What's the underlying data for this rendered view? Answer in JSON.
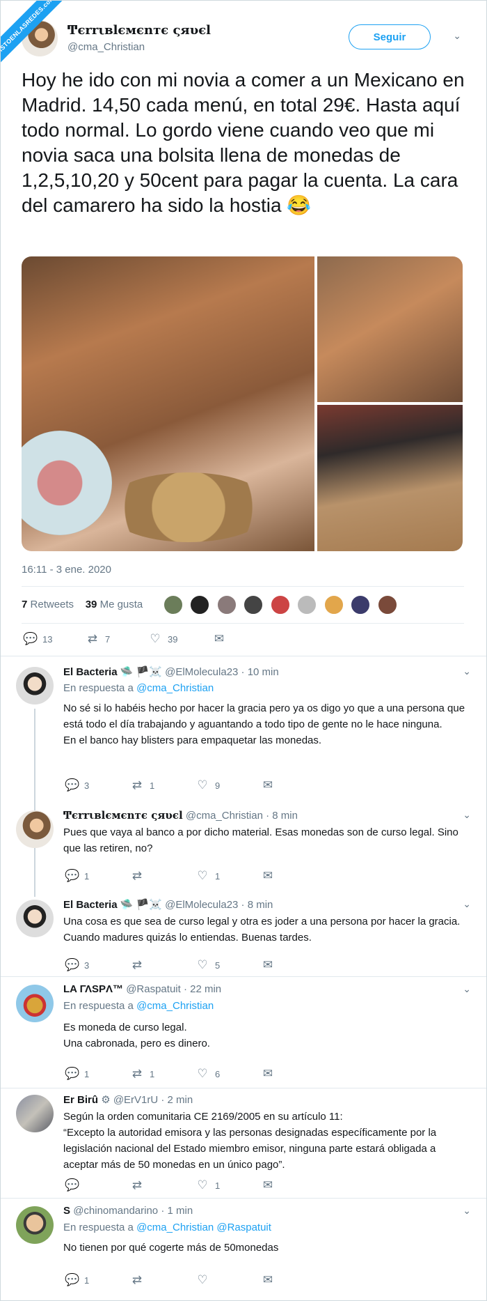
{
  "watermark": "VISTOENLASREDES.com",
  "main_tweet": {
    "display_name": "Ͳєrrιвlємєnтє ςяυєl",
    "handle": "@cma_Christian",
    "follow_label": "Seguir",
    "text": "Hoy he ido con mi novia a comer a un Mexicano en Madrid. 14,50 cada menú, en total 29€. Hasta aquí todo normal. Lo gordo viene cuando veo que mi novia saca una bolsita llena de monedas de 1,2,5,10,20 y 50cent para pagar la cuenta. La cara del camarero ha sido la hostia 😂",
    "timestamp": "16:11 - 3 ene. 2020",
    "retweets_count": "7",
    "retweets_label": "Retweets",
    "likes_count": "39",
    "likes_label": "Me gusta",
    "actions": {
      "reply": "13",
      "retweet": "7",
      "like": "39"
    }
  },
  "replies": [
    {
      "name": "El Bacteria",
      "handle": "@ElMolecula23 · 10 min",
      "in_reply_prefix": "En respuesta a",
      "in_reply_to": "@cma_Christian",
      "text1": "No sé si lo habéis hecho por hacer la gracia pero ya os digo yo que a una persona que está todo el día trabajando y aguantando a todo tipo de gente no le hace ninguna.",
      "text2": "En el banco hay blisters para empaquetar las monedas.",
      "reply": "3",
      "retweet": "1",
      "like": "9"
    },
    {
      "name": "Ͳєrrιвlємєnтє ςяυєl",
      "handle": "@cma_Christian · 8 min",
      "text1": "Pues que vaya al banco a por dicho material. Esas monedas son de curso legal. Sino que las retiren, no?",
      "reply": "1",
      "retweet": "",
      "like": "1"
    },
    {
      "name": "El Bacteria",
      "handle": "@ElMolecula23 · 8 min",
      "text1": "Una cosa es que sea de curso legal y otra es joder a una persona por hacer la gracia. Cuando madures quizás lo entiendas. Buenas tardes.",
      "reply": "3",
      "retweet": "",
      "like": "5"
    },
    {
      "name": "LA ΓΛSPΛ™",
      "handle": "@Raspatuit · 22 min",
      "in_reply_prefix": "En respuesta a",
      "in_reply_to": "@cma_Christian",
      "text1": "Es moneda de curso legal.",
      "text2": "Una cabronada, pero es dinero.",
      "reply": "1",
      "retweet": "1",
      "like": "6"
    },
    {
      "name": "Er Birû",
      "handle": "@ErV1rU · 2 min",
      "text1": "Según la orden comunitaria CE 2169/2005 en su artículo 11:",
      "text2": "“Excepto la autoridad emisora y las personas designadas específicamente por la legislación nacional del Estado miembro emisor, ninguna parte estará obligada a aceptar más de 50 monedas en un único pago”.",
      "reply": "",
      "retweet": "",
      "like": "1"
    },
    {
      "name": "S",
      "handle": "@chinomandarino · 1 min",
      "in_reply_prefix": "En respuesta a",
      "in_reply_to": "@cma_Christian @Raspatuit",
      "text1": "No tienen por qué cogerte más de 50monedas",
      "reply": "1",
      "retweet": "",
      "like": ""
    }
  ],
  "icons": {
    "reply": "speech-bubble",
    "retweet": "retweet-arrows",
    "like": "heart",
    "dm": "envelope",
    "more": "chevron-down"
  },
  "colors": {
    "accent": "#1da1f2",
    "muted": "#657786"
  }
}
